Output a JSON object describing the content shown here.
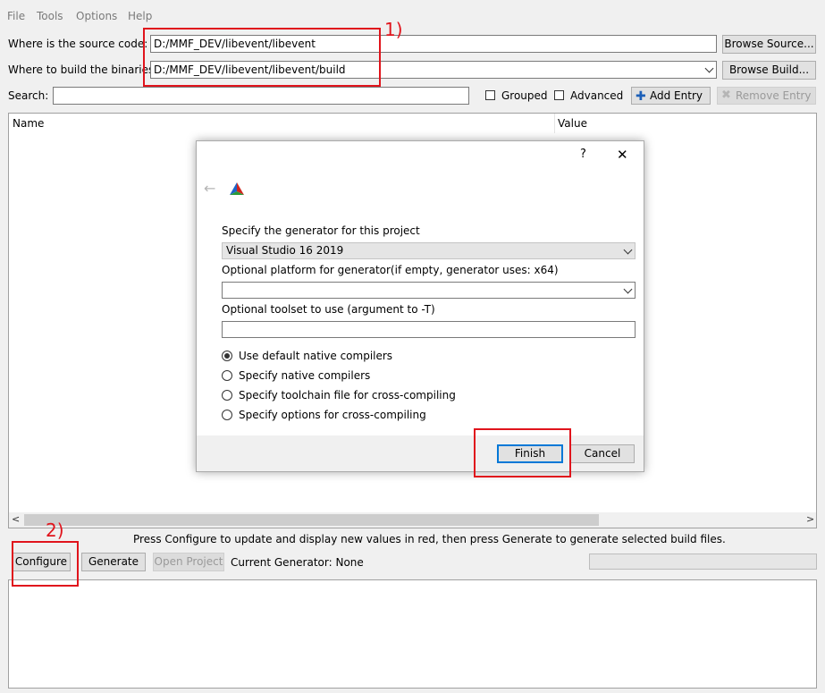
{
  "menu": {
    "file": "File",
    "tools": "Tools",
    "options": "Options",
    "help": "Help"
  },
  "paths": {
    "source_label": "Where is the source code:",
    "source_value": "D:/MMF_DEV/libevent/libevent",
    "build_label": "Where to build the binaries:",
    "build_value": "D:/MMF_DEV/libevent/libevent/build",
    "browse_source": "Browse Source...",
    "browse_build": "Browse Build..."
  },
  "search": {
    "label": "Search:",
    "value": ""
  },
  "filters": {
    "grouped": "Grouped",
    "grouped_checked": false,
    "advanced": "Advanced",
    "advanced_checked": false,
    "add_entry": "Add Entry",
    "remove_entry": "Remove Entry"
  },
  "table": {
    "col_name": "Name",
    "col_value": "Value"
  },
  "annotations": {
    "one": "1)",
    "two": "2)"
  },
  "status": {
    "hint": "Press Configure to update and display new values in red, then press Generate to generate selected build files."
  },
  "actions": {
    "configure": "Configure",
    "generate": "Generate",
    "open_project": "Open Project",
    "current_generator": "Current Generator: None"
  },
  "dialog": {
    "help_glyph": "?",
    "close_glyph": "✕",
    "back_glyph": "←",
    "generator_label": "Specify the generator for this project",
    "generator_value": "Visual Studio 16 2019",
    "platform_label": "Optional platform for generator(if empty, generator uses: x64)",
    "platform_value": "",
    "toolset_label": "Optional toolset to use (argument to -T)",
    "toolset_value": "",
    "options": [
      {
        "label": "Use default native compilers",
        "checked": true
      },
      {
        "label": "Specify native compilers",
        "checked": false
      },
      {
        "label": "Specify toolchain file for cross-compiling",
        "checked": false
      },
      {
        "label": "Specify options for cross-compiling",
        "checked": false
      }
    ],
    "finish": "Finish",
    "cancel": "Cancel"
  },
  "colors": {
    "annotation_red": "#e0141c",
    "finish_border": "#0078d7"
  }
}
